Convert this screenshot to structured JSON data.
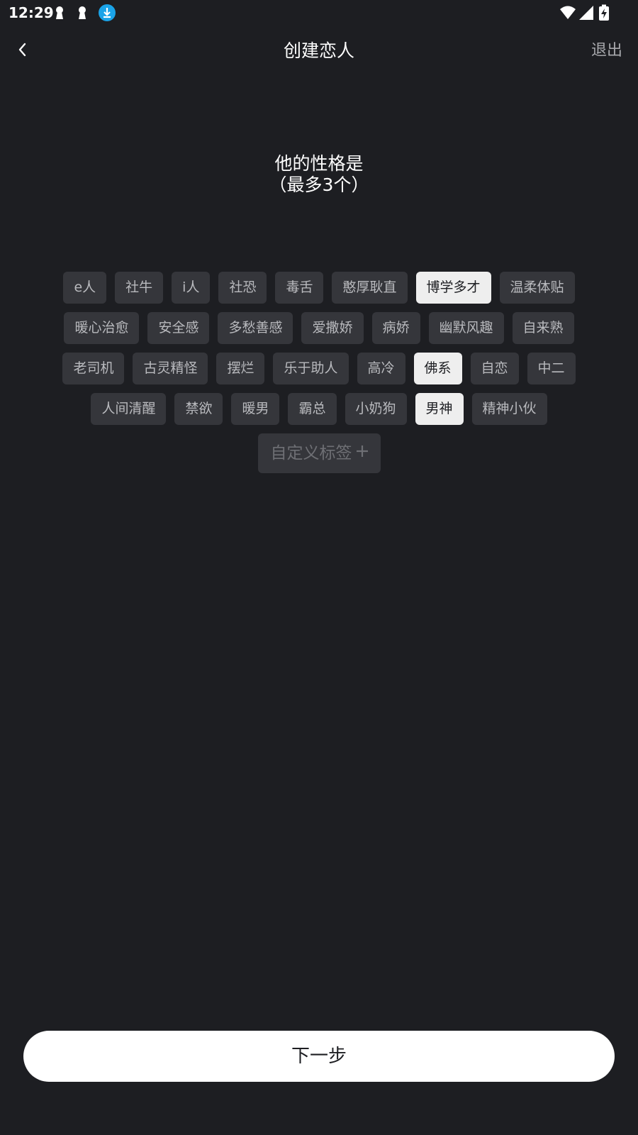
{
  "status_bar": {
    "time": "12:29"
  },
  "header": {
    "title": "创建恋人",
    "exit_label": "退出"
  },
  "question": {
    "line1": "他的性格是",
    "line2": "（最多3个）"
  },
  "tags": {
    "rows": [
      [
        {
          "label": "e人",
          "selected": false
        },
        {
          "label": "社牛",
          "selected": false
        },
        {
          "label": "i人",
          "selected": false
        },
        {
          "label": "社恐",
          "selected": false
        },
        {
          "label": "毒舌",
          "selected": false
        },
        {
          "label": "憨厚耿直",
          "selected": false
        },
        {
          "label": "博学多才",
          "selected": true
        },
        {
          "label": "温柔体贴",
          "selected": false
        }
      ],
      [
        {
          "label": "暖心治愈",
          "selected": false
        },
        {
          "label": "安全感",
          "selected": false
        },
        {
          "label": "多愁善感",
          "selected": false
        },
        {
          "label": "爱撒娇",
          "selected": false
        },
        {
          "label": "病娇",
          "selected": false
        },
        {
          "label": "幽默风趣",
          "selected": false
        },
        {
          "label": "自来熟",
          "selected": false
        }
      ],
      [
        {
          "label": "老司机",
          "selected": false
        },
        {
          "label": "古灵精怪",
          "selected": false
        },
        {
          "label": "摆烂",
          "selected": false
        },
        {
          "label": "乐于助人",
          "selected": false
        },
        {
          "label": "高冷",
          "selected": false
        },
        {
          "label": "佛系",
          "selected": true
        },
        {
          "label": "自恋",
          "selected": false
        },
        {
          "label": "中二",
          "selected": false
        }
      ],
      [
        {
          "label": "人间清醒",
          "selected": false
        },
        {
          "label": "禁欲",
          "selected": false
        },
        {
          "label": "暖男",
          "selected": false
        },
        {
          "label": "霸总",
          "selected": false
        },
        {
          "label": "小奶狗",
          "selected": false
        },
        {
          "label": "男神",
          "selected": true
        },
        {
          "label": "精神小伙",
          "selected": false
        }
      ]
    ],
    "custom_label": "自定义标签"
  },
  "footer": {
    "next_label": "下一步"
  },
  "colors": {
    "background": "#1d1e22",
    "tag_bg": "#35363b",
    "tag_text": "#b9babe",
    "tag_selected_bg": "#eeeeee",
    "tag_selected_text": "#1d1e22",
    "download_badge": "#1aa3e8"
  },
  "icons": {
    "status": [
      "keyhole-icon",
      "keyhole-icon",
      "download-icon",
      "wifi-icon",
      "signal-icon",
      "battery-charging-icon"
    ],
    "back": "chevron-left-icon",
    "custom_add": "plus-icon"
  }
}
